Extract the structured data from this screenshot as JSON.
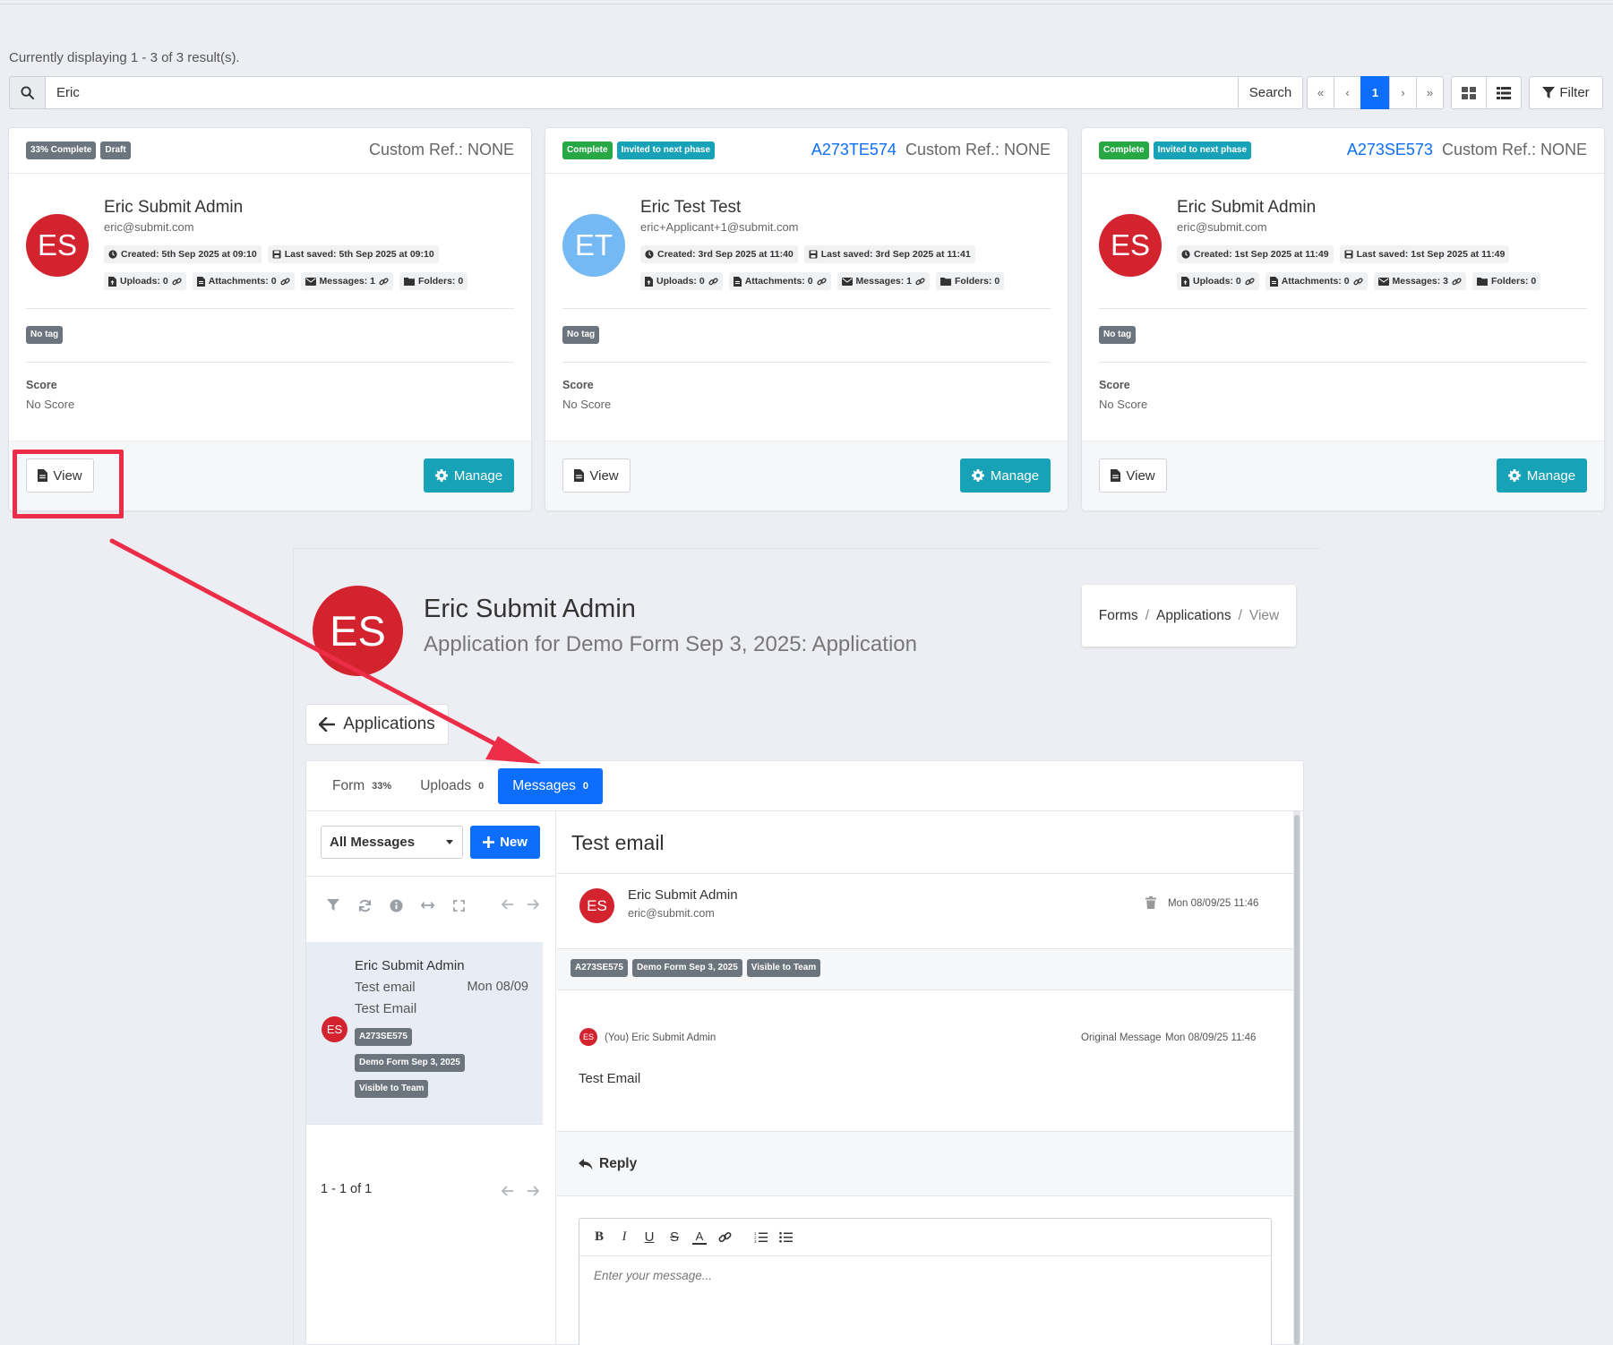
{
  "results": {
    "text": "Currently displaying 1 - 3 of 3 result(s)."
  },
  "search": {
    "value": "Eric",
    "button": "Search"
  },
  "pagination": {
    "first": "«",
    "prev": "‹",
    "current": "1",
    "next": "›",
    "last": "»"
  },
  "toolbar": {
    "filter_label": "Filter"
  },
  "cards": [
    {
      "badges": [
        {
          "text": "33% Complete",
          "color": "#6c757d"
        },
        {
          "text": "Draft",
          "color": "#6c757d"
        }
      ],
      "ref_id": "",
      "custom_ref": "Custom Ref.: NONE",
      "initials": "ES",
      "avatar_color": "#d3232f",
      "name": "Eric Submit Admin",
      "email": "eric@submit.com",
      "created": "Created: 5th Sep 2025 at 09:10",
      "last_saved": "Last saved: 5th Sep 2025 at 09:10",
      "uploads": "Uploads: 0",
      "attachments": "Attachments: 0",
      "messages": "Messages: 1",
      "folders": "Folders: 0",
      "tag": "No tag",
      "score_label": "Score",
      "score_value": "No Score",
      "view_label": "View",
      "manage_label": "Manage"
    },
    {
      "badges": [
        {
          "text": "Complete",
          "color": "#28a745"
        },
        {
          "text": "Invited to next phase",
          "color": "#17a2b8"
        }
      ],
      "ref_id": "A273TE574",
      "custom_ref": "Custom Ref.: NONE",
      "initials": "ET",
      "avatar_color": "#74b8f4",
      "name": "Eric Test Test",
      "email": "eric+Applicant+1@submit.com",
      "created": "Created: 3rd Sep 2025 at 11:40",
      "last_saved": "Last saved: 3rd Sep 2025 at 11:41",
      "uploads": "Uploads: 0",
      "attachments": "Attachments: 0",
      "messages": "Messages: 1",
      "folders": "Folders: 0",
      "tag": "No tag",
      "score_label": "Score",
      "score_value": "No Score",
      "view_label": "View",
      "manage_label": "Manage"
    },
    {
      "badges": [
        {
          "text": "Complete",
          "color": "#28a745"
        },
        {
          "text": "Invited to next phase",
          "color": "#17a2b8"
        }
      ],
      "ref_id": "A273SE573",
      "custom_ref": "Custom Ref.: NONE",
      "initials": "ES",
      "avatar_color": "#d3232f",
      "name": "Eric Submit Admin",
      "email": "eric@submit.com",
      "created": "Created: 1st Sep 2025 at 11:49",
      "last_saved": "Last saved: 1st Sep 2025 at 11:49",
      "uploads": "Uploads: 0",
      "attachments": "Attachments: 0",
      "messages": "Messages: 3",
      "folders": "Folders: 0",
      "tag": "No tag",
      "score_label": "Score",
      "score_value": "No Score",
      "view_label": "View",
      "manage_label": "Manage"
    }
  ],
  "detail": {
    "initials": "ES",
    "name": "Eric Submit Admin",
    "subtitle": "Application for Demo Form Sep 3, 2025: Application",
    "breadcrumb": [
      "Forms",
      "Applications",
      "View"
    ],
    "back_label": "Applications",
    "tabs": [
      {
        "label": "Form",
        "count": "33%"
      },
      {
        "label": "Uploads",
        "count": "0"
      },
      {
        "label": "Messages",
        "count": "0"
      }
    ],
    "active_tab": 2,
    "filter_select": "All Messages",
    "new_label": "New",
    "message_list": [
      {
        "initials": "ES",
        "sender": "Eric Submit Admin",
        "subject": "Test email",
        "date": "Mon 08/09",
        "preview": "Test Email",
        "tags": [
          "A273SE575",
          "Demo Form Sep 3, 2025",
          "Visible to Team"
        ]
      }
    ],
    "list_count": "1 - 1 of 1",
    "message": {
      "title": "Test email",
      "initials": "ES",
      "sender": "Eric Submit Admin",
      "email": "eric@submit.com",
      "date": "Mon 08/09/25 11:46",
      "tags": [
        "A273SE575",
        "Demo Form Sep 3, 2025",
        "Visible to Team"
      ],
      "thread_sender": "(You) Eric Submit Admin",
      "thread_label": "Original Message",
      "thread_date": "Mon 08/09/25 11:46",
      "body": "Test Email",
      "reply_label": "Reply",
      "editor_placeholder": "Enter your message..."
    }
  },
  "annotation": {
    "highlight_color": "#ec2d47"
  }
}
